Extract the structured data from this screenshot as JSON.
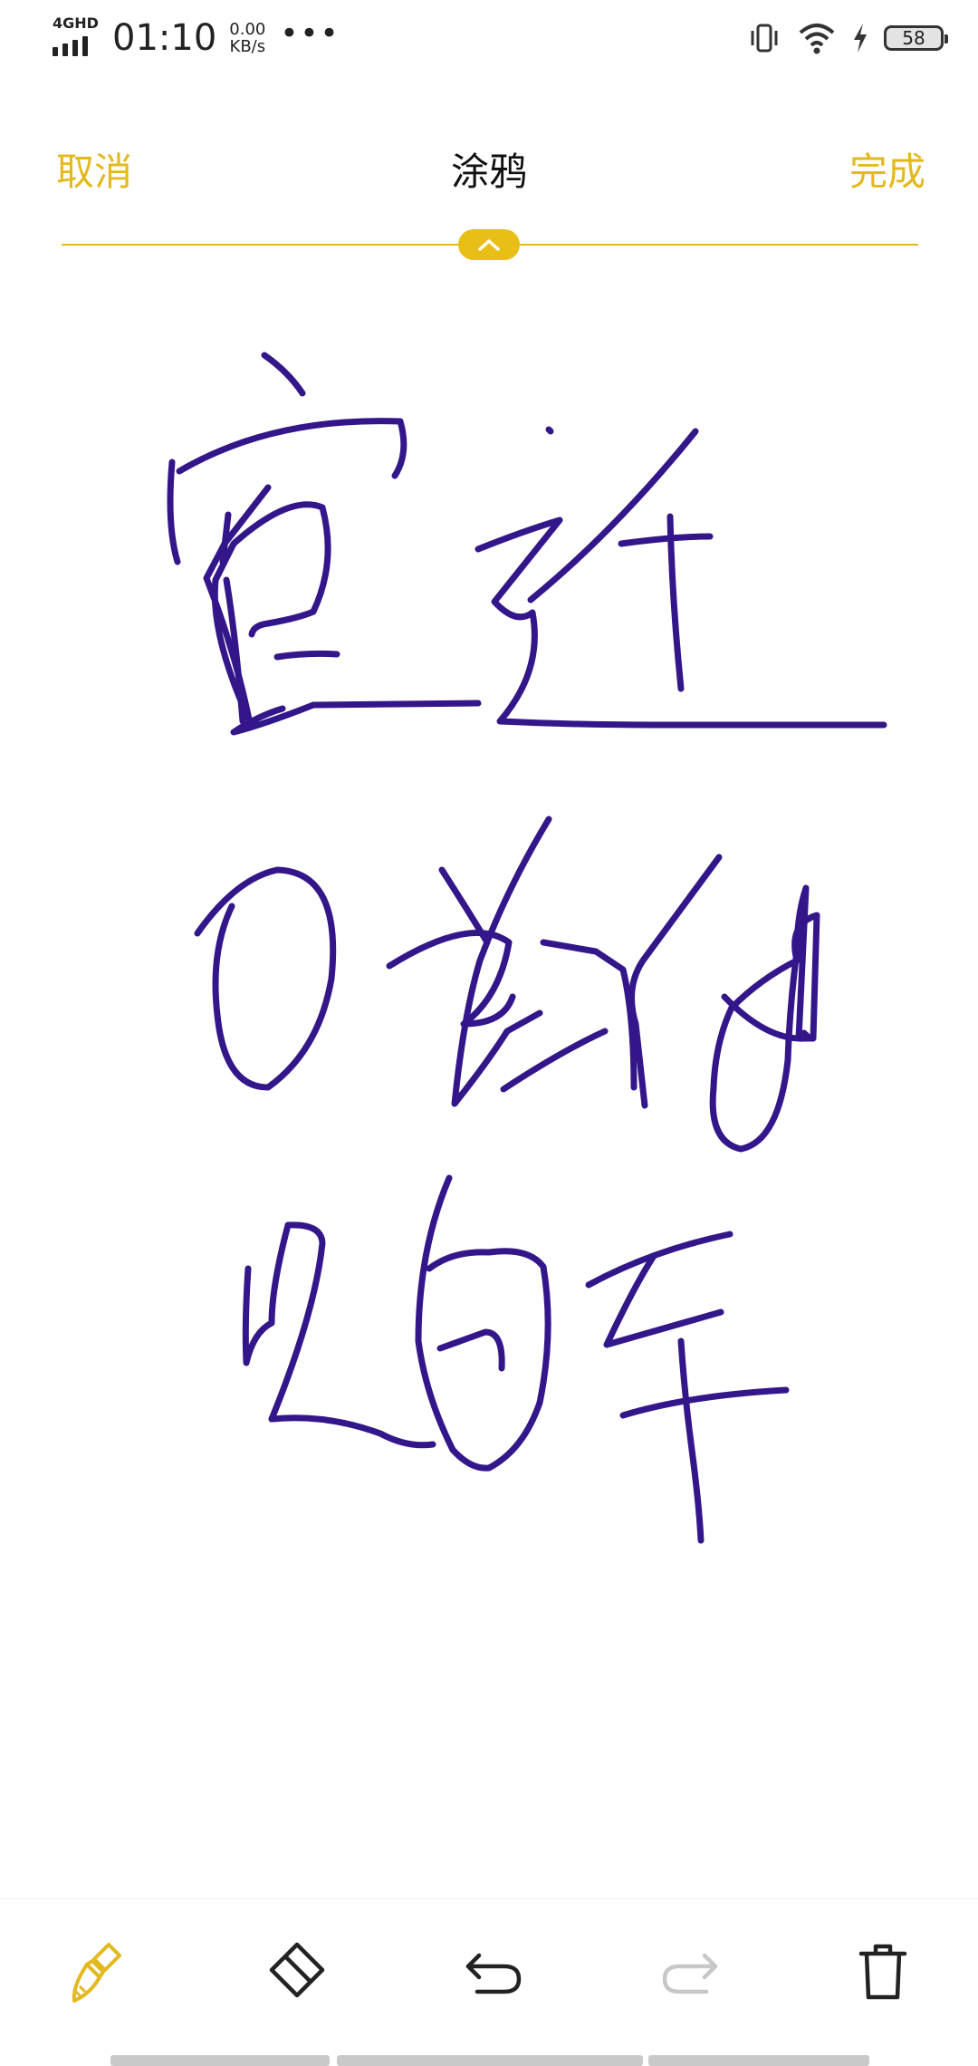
{
  "status_bar": {
    "network": "4GHD",
    "time": "01:10",
    "speed_value": "0.00",
    "speed_unit": "KB/s",
    "more": "•••",
    "battery_level": "58",
    "icons": [
      "vibrate-icon",
      "wifi-icon",
      "charging-icon",
      "battery-icon"
    ]
  },
  "header": {
    "cancel_label": "取消",
    "title": "涂鸦",
    "done_label": "完成"
  },
  "colors": {
    "accent": "#E4B91E",
    "ink": "#34168B",
    "handle": "#E9BE17"
  },
  "toolbar": {
    "items": [
      {
        "icon": "brush-icon",
        "active": true
      },
      {
        "icon": "eraser-icon",
        "active": false
      },
      {
        "icon": "undo-icon",
        "active": false
      },
      {
        "icon": "redo-icon",
        "active": false,
        "disabled": true
      },
      {
        "icon": "delete-icon",
        "active": false
      }
    ]
  }
}
